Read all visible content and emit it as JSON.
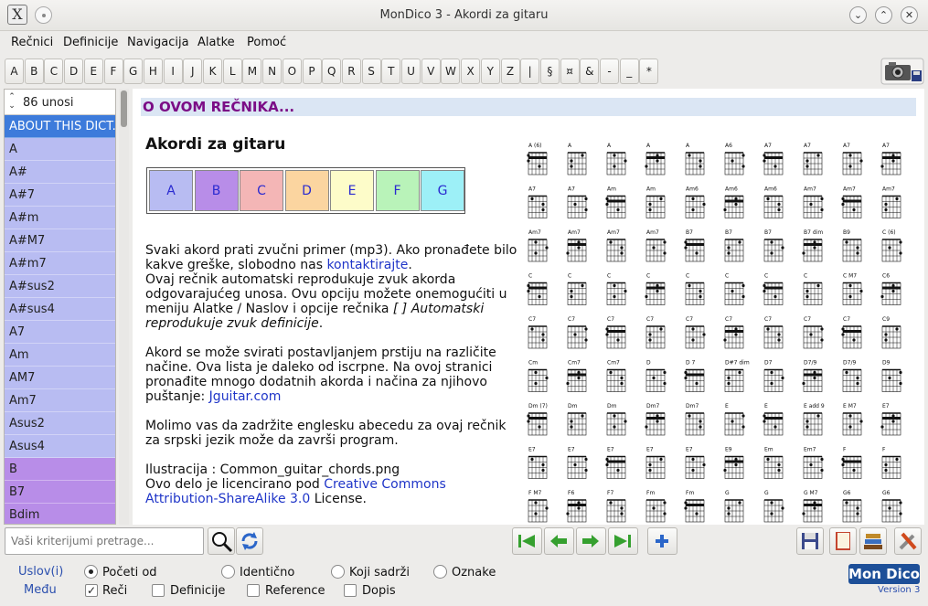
{
  "window": {
    "title": "MonDico 3 - Akordi za gitaru"
  },
  "menu": [
    "Rečnici",
    "Definicije",
    "Navigacija",
    "Alatke",
    "Pomoć"
  ],
  "letters": [
    "A",
    "B",
    "C",
    "D",
    "E",
    "F",
    "G",
    "H",
    "I",
    "J",
    "K",
    "L",
    "M",
    "N",
    "O",
    "P",
    "Q",
    "R",
    "S",
    "T",
    "U",
    "V",
    "W",
    "X",
    "Y",
    "Z",
    "|",
    "§",
    "¤",
    "&",
    "-",
    "_",
    "*"
  ],
  "list": {
    "count": "86 unosi",
    "entries": [
      {
        "label": "ABOUT THIS DICT...",
        "color": "#3d7bdb",
        "selected": true
      },
      {
        "label": "A",
        "color": "#b8bcf2"
      },
      {
        "label": "A#",
        "color": "#b8bcf2"
      },
      {
        "label": "A#7",
        "color": "#b8bcf2"
      },
      {
        "label": "A#m",
        "color": "#b8bcf2"
      },
      {
        "label": "A#M7",
        "color": "#b8bcf2"
      },
      {
        "label": "A#m7",
        "color": "#b8bcf2"
      },
      {
        "label": "A#sus2",
        "color": "#b8bcf2"
      },
      {
        "label": "A#sus4",
        "color": "#b8bcf2"
      },
      {
        "label": "A7",
        "color": "#b8bcf2"
      },
      {
        "label": "Am",
        "color": "#b8bcf2"
      },
      {
        "label": "AM7",
        "color": "#b8bcf2"
      },
      {
        "label": "Am7",
        "color": "#b8bcf2"
      },
      {
        "label": "Asus2",
        "color": "#b8bcf2"
      },
      {
        "label": "Asus4",
        "color": "#b8bcf2"
      },
      {
        "label": "B",
        "color": "#b88de8"
      },
      {
        "label": "B7",
        "color": "#b88de8"
      },
      {
        "label": "Bdim",
        "color": "#b88de8"
      }
    ]
  },
  "content": {
    "header": "O OVOM REČNIKA...",
    "title": "Akordi za gitaru",
    "keys": [
      {
        "label": "A",
        "color": "#b8bcf2"
      },
      {
        "label": "B",
        "color": "#b88de8"
      },
      {
        "label": "C",
        "color": "#f4b6b6"
      },
      {
        "label": "D",
        "color": "#fbd5a0"
      },
      {
        "label": "E",
        "color": "#fdfcc9"
      },
      {
        "label": "F",
        "color": "#b9f3b9"
      },
      {
        "label": "G",
        "color": "#9df0f7"
      }
    ],
    "p1": {
      "a": "Svaki akord prati zvučni primer (mp3). Ako pronađete bilo kakve greške, slobodno nas ",
      "link": "kontaktirajte",
      "b": ".",
      "c": "Ovaj rečnik automatski reprodukuje zvuk akorda odgovarajućeg unosa. Ovu opciju možete onemogućiti u meniju Alatke / Naslov i opcije rečnika ",
      "ital": "[ ] Automatski reprodukuje zvuk definicije",
      "d": "."
    },
    "p2": {
      "a": "Akord se može svirati postavljanjem prstiju na različite načine. Ova lista je daleko od iscrpne. Na ovoj stranici pronađite mnogo dodatnih akorda i načina za njihovo puštanje: ",
      "link": "Jguitar.com"
    },
    "p3": "Molimo vas da zadržite englesku abecedu za ovaj rečnik za srpski jezik može da završi program.",
    "p4": {
      "a": "Ilustracija : Common_guitar_chords.png",
      "b": "Ovo delo je licencirano pod ",
      "link": "Creative Commons Attribution-ShareAlike 3.0",
      "c": " License."
    },
    "chord_labels": [
      [
        "A (6)",
        "A",
        "A",
        "A",
        "A",
        "A6",
        "A7",
        "A7",
        "A7",
        "A7"
      ],
      [
        "A7",
        "A7",
        "Am",
        "Am",
        "Am6",
        "Am6",
        "Am6",
        "Am7",
        "Am7",
        "Am7"
      ],
      [
        "Am7",
        "Am7",
        "Am7",
        "Am7",
        "B7",
        "B7",
        "B7",
        "B7 dim",
        "B9",
        "C (6)"
      ],
      [
        "C",
        "C",
        "C",
        "C",
        "C",
        "C",
        "C",
        "C",
        "C M7",
        "C6"
      ],
      [
        "C7",
        "C7",
        "C7",
        "C7",
        "C7",
        "C7",
        "C7",
        "C7",
        "C7",
        "C9"
      ],
      [
        "Cm",
        "Cm7",
        "Cm7",
        "D",
        "D 7",
        "D#7 dim",
        "D7",
        "D7/9",
        "D7/9",
        "D9"
      ],
      [
        "Dm (7)",
        "Dm",
        "Dm",
        "Dm7",
        "Dm7",
        "E",
        "E",
        "E add 9",
        "E M7",
        "E7"
      ],
      [
        "E7",
        "E7",
        "E7",
        "E7",
        "E7",
        "E9",
        "Em",
        "Em7",
        "F",
        "F"
      ],
      [
        "F M7",
        "F6",
        "F7",
        "Fm",
        "Fm",
        "G",
        "G",
        "G M7",
        "G6",
        "G6"
      ]
    ]
  },
  "search": {
    "placeholder": "Vaši kriterijumi pretrage..."
  },
  "bottom": {
    "uslov": "Uslov(i)",
    "medu": "Među",
    "radios": [
      {
        "label": "Početi od",
        "checked": true
      },
      {
        "label": "Identično",
        "checked": false
      },
      {
        "label": "Koji sadrži",
        "checked": false
      },
      {
        "label": "Oznake",
        "checked": false
      }
    ],
    "checks": [
      {
        "label": "Reči",
        "checked": true
      },
      {
        "label": "Definicije",
        "checked": false
      },
      {
        "label": "Reference",
        "checked": false
      },
      {
        "label": "Dopis",
        "checked": false
      }
    ],
    "logo": "Mon Dico",
    "version": "Version 3"
  },
  "colors": {
    "accent": "#3d7bdb",
    "header_text": "#7b0d86",
    "link": "#1f35c8",
    "nav_green": "#35a02f",
    "nav_blue": "#2b66c9"
  }
}
